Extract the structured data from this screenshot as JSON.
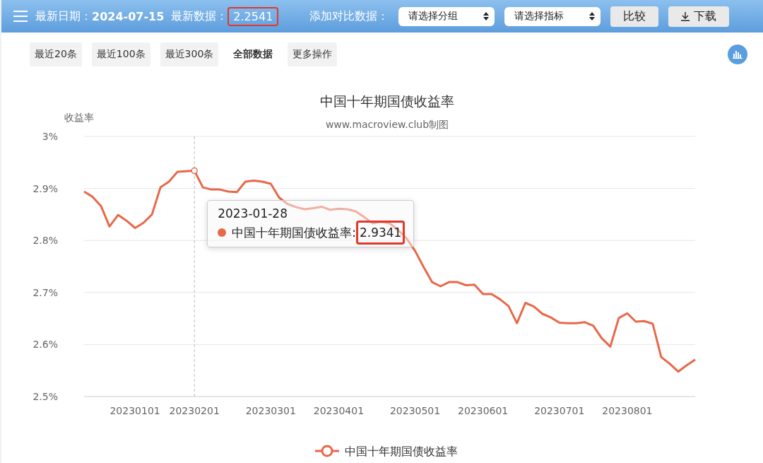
{
  "header": {
    "date_label": "最新日期：",
    "date": "2024-07-15",
    "latest_label": "最新数据：",
    "latest_value": "2.2541",
    "latest_highlighted": true,
    "compare_label": "添加对比数据：",
    "selects": [
      {
        "label": "请选择分组"
      },
      {
        "label": "请选择指标"
      }
    ],
    "buttons": [
      {
        "label": "比较",
        "kind": "plain"
      },
      {
        "label": "下载",
        "kind": "download"
      }
    ]
  },
  "range_buttons": [
    {
      "label": "最近20条",
      "selected": false
    },
    {
      "label": "最近100条",
      "selected": false
    },
    {
      "label": "最近300条",
      "selected": false
    },
    {
      "label": "全部数据",
      "selected": true
    },
    {
      "label": "更多操作",
      "selected": false
    }
  ],
  "chart": {
    "subtitle": "www.macroview.club制图",
    "tooltip": {
      "date": "2023-01-28",
      "series": "中国十年期国债收益率:",
      "value": "2.9341",
      "highlighted": true
    },
    "chart_data": {
      "type": "line",
      "title": "中国十年期国债收益率",
      "ylabel": "收益率",
      "categories": [
        null,
        null,
        null,
        null,
        null,
        null,
        "20230101",
        null,
        null,
        null,
        null,
        null,
        null,
        "20230201",
        null,
        null,
        null,
        null,
        null,
        null,
        null,
        null,
        "20230301",
        null,
        null,
        null,
        null,
        null,
        null,
        null,
        "20230401",
        null,
        null,
        null,
        null,
        null,
        null,
        null,
        null,
        "20230501",
        null,
        null,
        null,
        null,
        null,
        null,
        null,
        "20230601",
        null,
        null,
        null,
        null,
        null,
        null,
        null,
        null,
        "20230701",
        null,
        null,
        null,
        null,
        null,
        null,
        null,
        "20230801",
        null,
        null,
        null,
        null,
        null,
        null,
        null,
        null
      ],
      "series": [
        {
          "name": "中国十年期国债收益率",
          "color": "#e8684a",
          "values": [
            2.894,
            2.884,
            2.866,
            2.827,
            2.849,
            2.838,
            2.824,
            2.834,
            2.85,
            2.902,
            2.913,
            2.932,
            2.933,
            2.934,
            2.902,
            2.898,
            2.898,
            2.894,
            2.893,
            2.913,
            2.915,
            2.913,
            2.909,
            2.882,
            2.87,
            2.864,
            2.86,
            2.862,
            2.865,
            2.859,
            2.861,
            2.86,
            2.856,
            2.845,
            2.833,
            2.836,
            2.833,
            2.82,
            2.804,
            2.78,
            2.749,
            2.72,
            2.712,
            2.72,
            2.72,
            2.714,
            2.715,
            2.697,
            2.697,
            2.687,
            2.674,
            2.641,
            2.68,
            2.673,
            2.659,
            2.652,
            2.642,
            2.641,
            2.641,
            2.643,
            2.636,
            2.612,
            2.596,
            2.651,
            2.66,
            2.644,
            2.645,
            2.64,
            2.576,
            2.563,
            2.548,
            2.56,
            2.571
          ]
        }
      ],
      "grid": true,
      "ylim": [
        2.5,
        3
      ],
      "yticks": [
        {
          "value": 2.5,
          "label": "2.5%"
        },
        {
          "value": 2.6,
          "label": "2.6%"
        },
        {
          "value": 2.7,
          "label": "2.7%"
        },
        {
          "value": 2.8,
          "label": "2.8%"
        },
        {
          "value": 2.9,
          "label": "2.9%"
        },
        {
          "value": 3,
          "label": "3%"
        }
      ]
    }
  }
}
